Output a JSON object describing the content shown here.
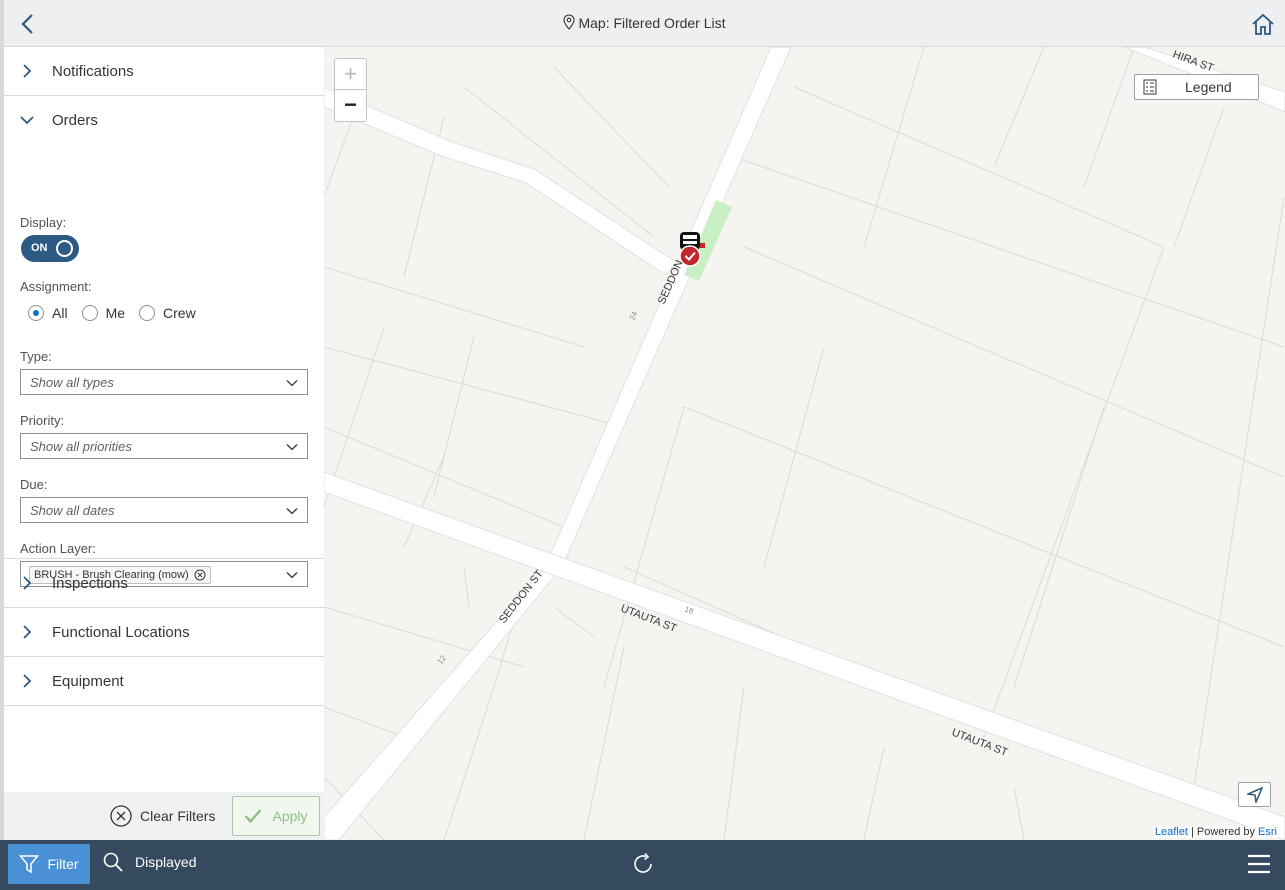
{
  "header": {
    "title": "Map: Filtered Order List"
  },
  "sidebar": {
    "sections": {
      "notifications": "Notifications",
      "orders": "Orders",
      "inspections": "Inspections",
      "functional_locations": "Functional Locations",
      "equipment": "Equipment"
    },
    "orders": {
      "display_label": "Display:",
      "display_toggle": "ON",
      "assignment_label": "Assignment:",
      "assignment_options": [
        "All",
        "Me",
        "Crew"
      ],
      "assignment_selected": "All",
      "type_label": "Type:",
      "type_value": "Show all types",
      "priority_label": "Priority:",
      "priority_value": "Show all priorities",
      "due_label": "Due:",
      "due_value": "Show all dates",
      "action_layer_label": "Action Layer:",
      "action_layer_token": "BRUSH - Brush Clearing (mow)"
    },
    "footer": {
      "clear_filters": "Clear Filters",
      "apply": "Apply"
    }
  },
  "map": {
    "zoom_in": "+",
    "zoom_out": "−",
    "legend": "Legend",
    "street_labels": {
      "seddon_st_upper": "SEDDON",
      "seddon_st_lower": "SEDDON ST",
      "utauta_st_1": "UTAUTA ST",
      "utauta_st_2": "UTAUTA ST",
      "hira_st": "HIRA ST"
    },
    "house_numbers": [
      "24",
      "18",
      "12"
    ],
    "attribution": {
      "leaflet": "Leaflet",
      "separator": " | Powered by ",
      "esri": "Esri"
    }
  },
  "toolbar": {
    "filter": "Filter",
    "displayed": "Displayed"
  },
  "colors": {
    "shell_dark": "#354a5f",
    "accent_blue": "#4a90d4",
    "toggle_on": "#2c5a82",
    "marker_red": "#c0282c"
  }
}
